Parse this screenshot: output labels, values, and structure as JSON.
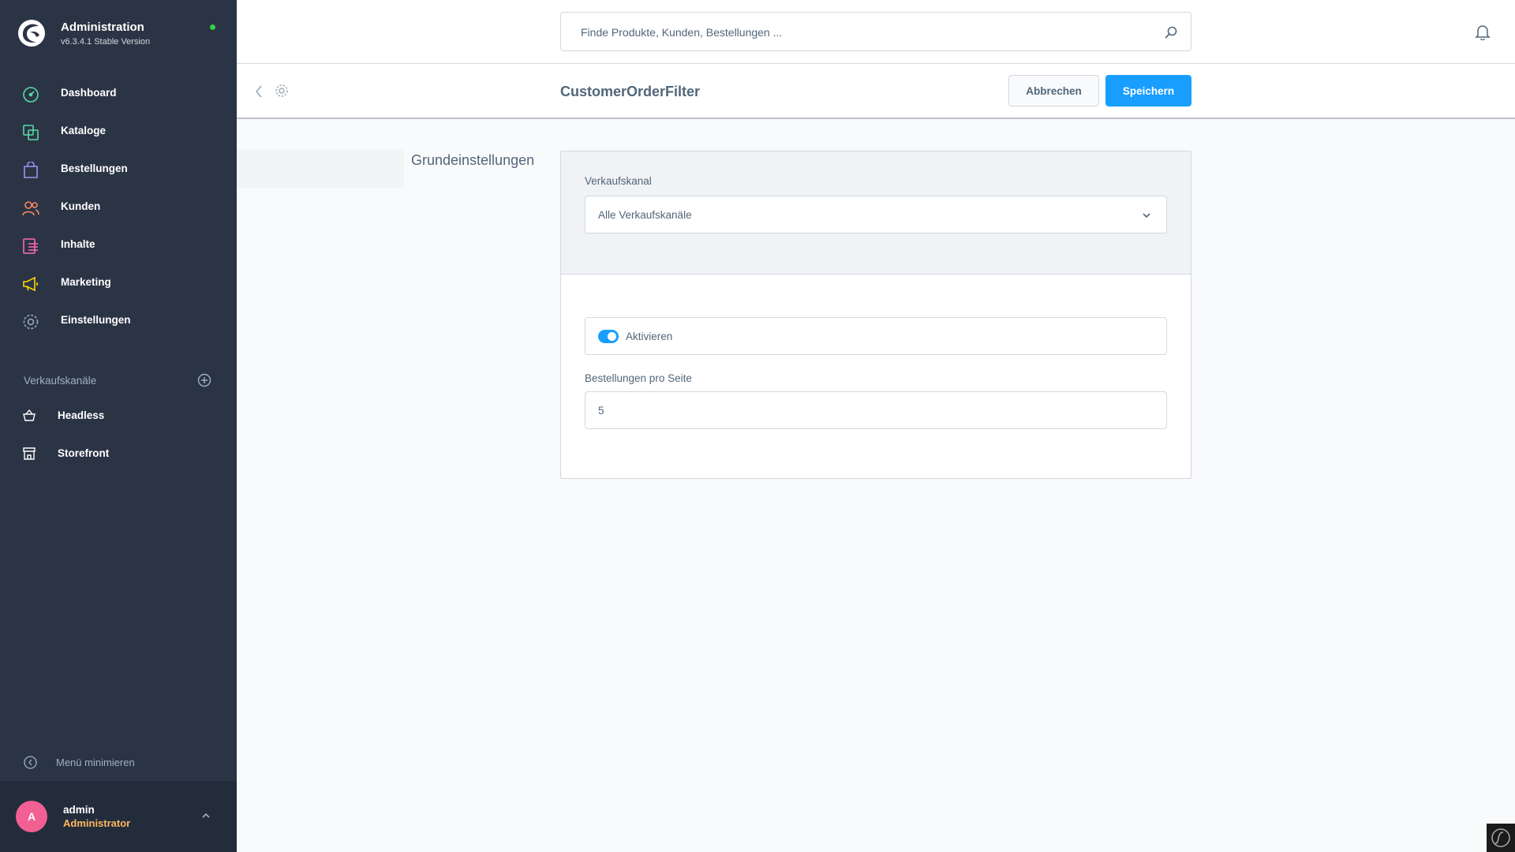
{
  "brand": {
    "title": "Administration",
    "version": "v6.3.4.1 Stable Version"
  },
  "nav": [
    {
      "label": "Dashboard",
      "icon": "dashboard-icon",
      "color": "#57d9a3"
    },
    {
      "label": "Kataloge",
      "icon": "catalog-icon",
      "color": "#57d9a3"
    },
    {
      "label": "Bestellungen",
      "icon": "orders-icon",
      "color": "#a092f0"
    },
    {
      "label": "Kunden",
      "icon": "customers-icon",
      "color": "#f88962"
    },
    {
      "label": "Inhalte",
      "icon": "content-icon",
      "color": "#ff68b4"
    },
    {
      "label": "Marketing",
      "icon": "marketing-icon",
      "color": "#ffd700"
    },
    {
      "label": "Einstellungen",
      "icon": "settings-icon",
      "color": "#9aa8b5"
    }
  ],
  "channels": {
    "title": "Verkaufskanäle",
    "items": [
      {
        "label": "Headless",
        "icon": "basket-icon"
      },
      {
        "label": "Storefront",
        "icon": "storefront-icon"
      }
    ]
  },
  "sidebar_footer": {
    "minimize_label": "Menü minimieren",
    "user_initial": "A",
    "user_name": "admin",
    "user_role": "Administrator"
  },
  "search": {
    "placeholder": "Finde Produkte, Kunden, Bestellungen ..."
  },
  "smartbar": {
    "title": "CustomerOrderFilter",
    "cancel_label": "Abbrechen",
    "save_label": "Speichern"
  },
  "settings": {
    "section_label": "Grundeinstellungen",
    "sales_channel_label": "Verkaufskanal",
    "sales_channel_value": "Alle Verkaufskanäle",
    "activate_label": "Aktivieren",
    "activate_value": true,
    "orders_per_page_label": "Bestellungen pro Seite",
    "orders_per_page_value": "5"
  },
  "colors": {
    "sidebar_bg": "#2b3445",
    "primary": "#189eff",
    "avatar": "#f25f92",
    "role": "#ffb75d"
  }
}
